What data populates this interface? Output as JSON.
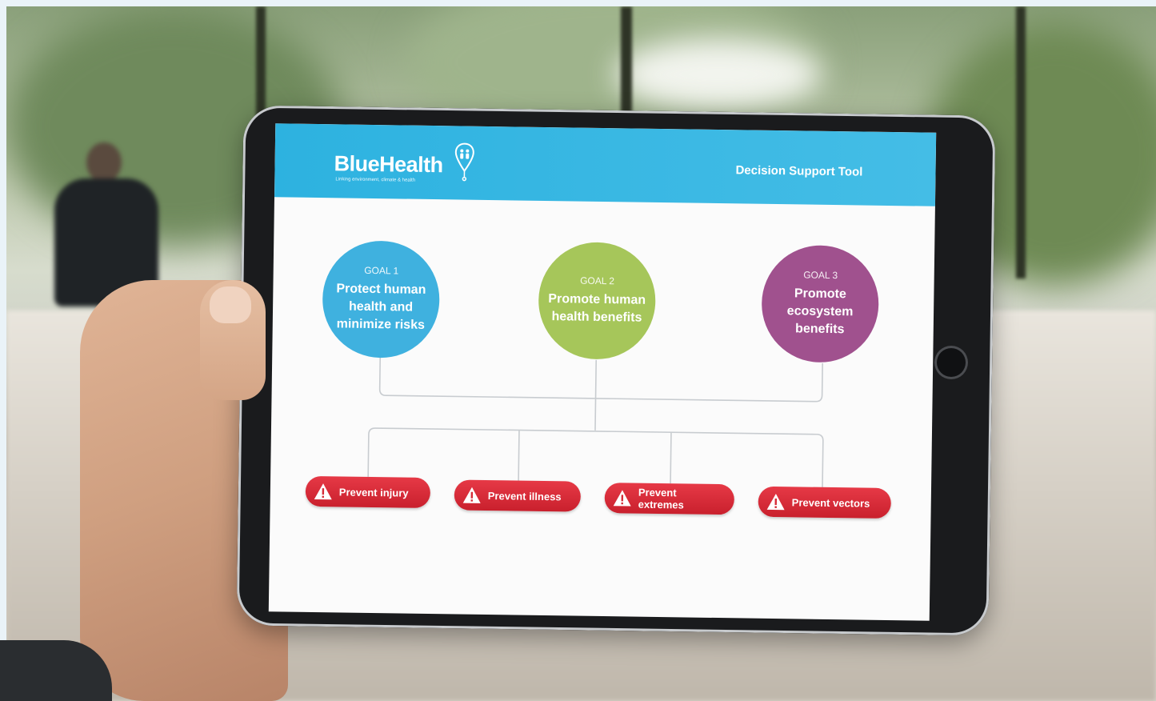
{
  "app": {
    "logo": "BlueHealth",
    "tagline": "Linking environment, climate & health",
    "title": "Decision Support Tool"
  },
  "goals": [
    {
      "kicker": "GOAL 1",
      "text": "Protect human health and minimize risks",
      "color": "#3fb1df"
    },
    {
      "kicker": "GOAL 2",
      "text": "Promote human health benefits",
      "color": "#a6c65a"
    },
    {
      "kicker": "GOAL 3",
      "text": "Promote ecosystem benefits",
      "color": "#a0518e"
    }
  ],
  "actions": [
    {
      "label": "Prevent injury",
      "icon": "warning-icon"
    },
    {
      "label": "Prevent illness",
      "icon": "warning-icon"
    },
    {
      "label": "Prevent extremes",
      "icon": "warning-icon"
    },
    {
      "label": "Prevent vectors",
      "icon": "warning-icon"
    }
  ],
  "colors": {
    "header": "#2db2e0",
    "action": "#d62b37"
  }
}
